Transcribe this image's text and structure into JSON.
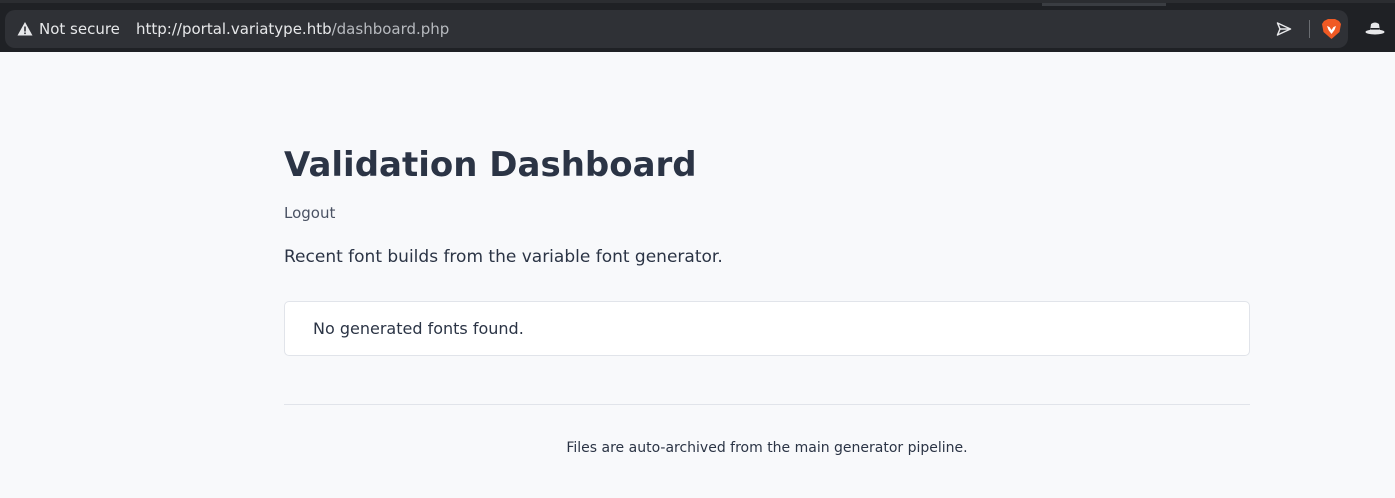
{
  "browser": {
    "security_label": "Not secure",
    "url_host": "http://portal.variatype.htb",
    "url_path": "/dashboard.php",
    "icons": [
      "warning-icon",
      "send-icon",
      "brave-lion-icon",
      "hat-icon"
    ],
    "colors": {
      "brave_orange": "#f05a24"
    }
  },
  "page": {
    "title": "Validation Dashboard",
    "logout_label": "Logout",
    "intro": "Recent font builds from the variable font generator.",
    "empty_message": "No generated fonts found.",
    "footer_note": "Files are auto-archived from the main generator pipeline."
  }
}
